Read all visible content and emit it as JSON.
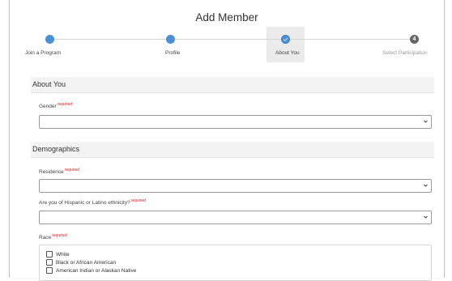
{
  "header": {
    "title": "Add Member"
  },
  "steps": [
    {
      "label": "Join a Program",
      "state": "done"
    },
    {
      "label": "Profile",
      "state": "done"
    },
    {
      "label": "About You",
      "state": "current"
    },
    {
      "label": "Select Participation",
      "state": "todo",
      "number": "4"
    }
  ],
  "sections": {
    "about_you": {
      "title": "About You",
      "gender_label": "Gender",
      "gender_value": ""
    },
    "demographics": {
      "title": "Demographics",
      "residence_label": "Residence",
      "residence_value": "",
      "ethnicity_label": "Are you of Hispanic or Latino ethnicity?",
      "ethnicity_value": "",
      "race_label": "Race",
      "race_options": [
        "White",
        "Black or African American",
        "American Indian or Alaskan Native"
      ]
    }
  },
  "required_text": "required",
  "colors": {
    "step_complete": "#4a90d9",
    "step_todo": "#666666",
    "required": "#dd2222"
  },
  "icons": {
    "check": "check-icon",
    "chevron": "chevron-down-icon"
  }
}
